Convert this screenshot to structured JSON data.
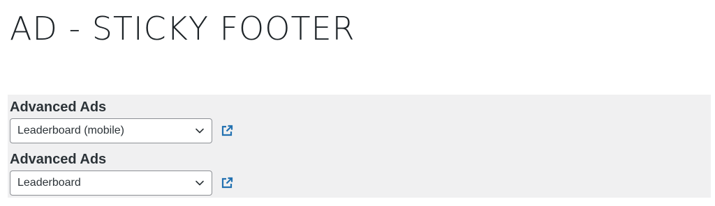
{
  "page": {
    "title": "AD - STICKY FOOTER"
  },
  "widgets": [
    {
      "label": "Advanced Ads",
      "selected": "Leaderboard (mobile)"
    },
    {
      "label": "Advanced Ads",
      "selected": "Leaderboard"
    }
  ],
  "colors": {
    "panel_background": "#f0f0f1",
    "link_icon": "#2271b1"
  },
  "icons": {
    "dropdown": "chevron-down-icon",
    "edit_link": "external-link-icon"
  }
}
